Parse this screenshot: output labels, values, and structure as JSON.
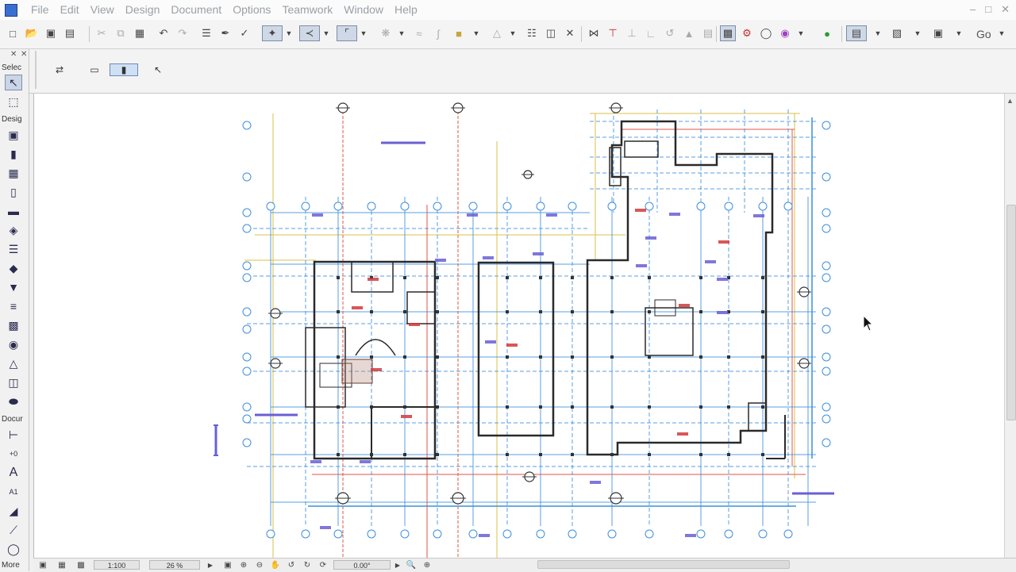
{
  "menubar": {
    "items": [
      "File",
      "Edit",
      "View",
      "Design",
      "Document",
      "Options",
      "Teamwork",
      "Window",
      "Help"
    ],
    "window_controls": [
      "–",
      "□",
      "✕"
    ]
  },
  "toolbar": {
    "go_label": "Go",
    "buttons": [
      "new-icon",
      "open-icon",
      "save-icon",
      "print-icon",
      "cut-icon",
      "copy-icon",
      "paste-icon",
      "undo-icon",
      "redo-icon",
      "find-select-icon",
      "pick-up-parameters-icon",
      "inject-parameters-icon",
      "magic-wand-icon",
      "gravity-icon",
      "offset-icon",
      "trim-icon",
      "split-icon",
      "adjust-icon",
      "intersect-icon",
      "fillet-icon",
      "resize-icon",
      "explode-icon",
      "hotlink-icon",
      "3d-window-icon",
      "section-icon",
      "layer-icon",
      "render-icon",
      "view-icon",
      "layout-icon"
    ]
  },
  "infobox": {
    "icons": [
      "marquee-icon",
      "rectangle-icon",
      "rotated-rectangle-icon",
      "pointer-icon"
    ]
  },
  "toolbox": {
    "sections": {
      "select": "Selec",
      "design": "Desig",
      "document": "Docur",
      "more": "More"
    },
    "select_tools": [
      "arrow-tool-icon",
      "marquee-tool-icon"
    ],
    "design_tools": [
      "wall-tool-icon",
      "column-tool-icon",
      "beam-tool-icon",
      "window-tool-icon",
      "door-tool-icon",
      "slab-tool-icon",
      "roof-tool-icon",
      "shell-tool-icon",
      "skylight-tool-icon",
      "curtain-wall-tool-icon",
      "stair-tool-icon",
      "railing-tool-icon",
      "mesh-tool-icon",
      "morph-tool-icon",
      "object-tool-icon",
      "zone-tool-icon"
    ],
    "document_tools": [
      "dimension-tool-icon",
      "level-dimension-tool-icon",
      "text-tool-icon",
      "label-tool-icon",
      "fill-tool-icon",
      "line-tool-icon",
      "circle-tool-icon"
    ],
    "document_glyphs": {
      "text_tool": "A",
      "label_tool": "A1",
      "level_tool": "+0"
    }
  },
  "statusbar": {
    "scale": "1:100",
    "zoom": "26 %",
    "angle": "0.00°"
  },
  "colors": {
    "grid_blue": "#3d8fdc",
    "axis_red": "#e05545",
    "axis_yellow": "#d8c24a",
    "wall_black": "#2a2a2a",
    "label_red": "#d23a3a",
    "label_purple": "#6a5fd4"
  }
}
